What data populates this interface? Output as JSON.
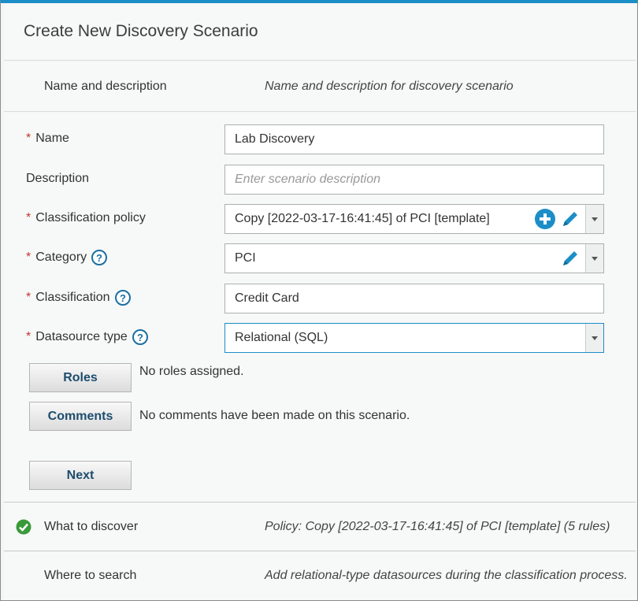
{
  "dialog": {
    "title": "Create New Discovery Scenario"
  },
  "steps": [
    {
      "name": "Name and description",
      "summary": "Name and description for discovery scenario"
    },
    {
      "name": "What to discover",
      "summary": "Policy: Copy [2022-03-17-16:41:45] of PCI [template] (5 rules)"
    },
    {
      "name": "Where to search",
      "summary": "Add relational-type datasources during the classification process."
    }
  ],
  "form": {
    "required_mark": "*",
    "name": {
      "label": "Name",
      "value": "Lab Discovery"
    },
    "description": {
      "label": "Description",
      "placeholder": "Enter scenario description"
    },
    "classification_policy": {
      "label": "Classification policy",
      "value": "Copy [2022-03-17-16:41:45] of PCI [template]"
    },
    "category": {
      "label": "Category",
      "value": "PCI"
    },
    "classification": {
      "label": "Classification",
      "value": "Credit Card"
    },
    "datasource_type": {
      "label": "Datasource type",
      "value": "Relational (SQL)"
    }
  },
  "buttons": {
    "roles": {
      "label": "Roles",
      "note": "No roles assigned."
    },
    "comments": {
      "label": "Comments",
      "note": "No comments have been made on this scenario."
    },
    "next": {
      "label": "Next"
    }
  },
  "icons": {
    "help": "question-circle-icon",
    "add": "plus-circle-icon",
    "edit": "pencil-icon",
    "dropdown": "chevron-down-icon",
    "complete": "check-circle-icon"
  },
  "colors": {
    "accent": "#1c8ec7",
    "required": "#c0392b",
    "button_text": "#1d4d6e",
    "success": "#3a9a3a"
  }
}
